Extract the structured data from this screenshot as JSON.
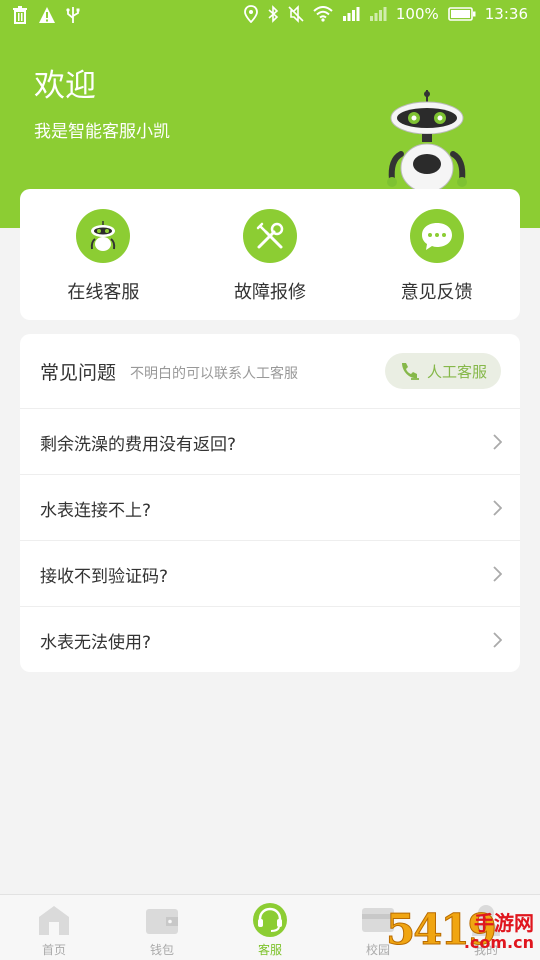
{
  "status_bar": {
    "battery": "100%",
    "time": "13:36",
    "icons_left": [
      "trash-icon",
      "warning-icon",
      "usb-icon"
    ],
    "icons_right": [
      "location-icon",
      "bluetooth-icon",
      "mute-icon",
      "wifi-icon",
      "signal-icon",
      "signal-icon",
      "battery-icon"
    ]
  },
  "header": {
    "title": "欢迎",
    "subtitle": "我是智能客服小凯"
  },
  "shortcuts": [
    {
      "label": "在线客服",
      "icon": "robot-icon"
    },
    {
      "label": "故障报修",
      "icon": "tools-icon"
    },
    {
      "label": "意见反馈",
      "icon": "chat-bubble-icon"
    }
  ],
  "faq": {
    "title": "常见问题",
    "hint": "不明白的可以联系人工客服",
    "human_button": "人工客服",
    "questions": [
      "剩余洗澡的费用没有返回?",
      "水表连接不上?",
      "接收不到验证码?",
      "水表无法使用?"
    ]
  },
  "tabs": [
    {
      "label": "首页",
      "icon": "home-icon",
      "active": false
    },
    {
      "label": "钱包",
      "icon": "wallet-icon",
      "active": false
    },
    {
      "label": "客服",
      "icon": "headset-icon",
      "active": true
    },
    {
      "label": "校园",
      "icon": "card-icon",
      "active": false
    },
    {
      "label": "我的",
      "icon": "person-icon",
      "active": false
    }
  ],
  "watermark": {
    "digits": "5419",
    "cn": "手游网",
    "com": ".com.cn"
  },
  "colors": {
    "brand": "#8ccd33",
    "accent_text": "#7cc22a"
  }
}
